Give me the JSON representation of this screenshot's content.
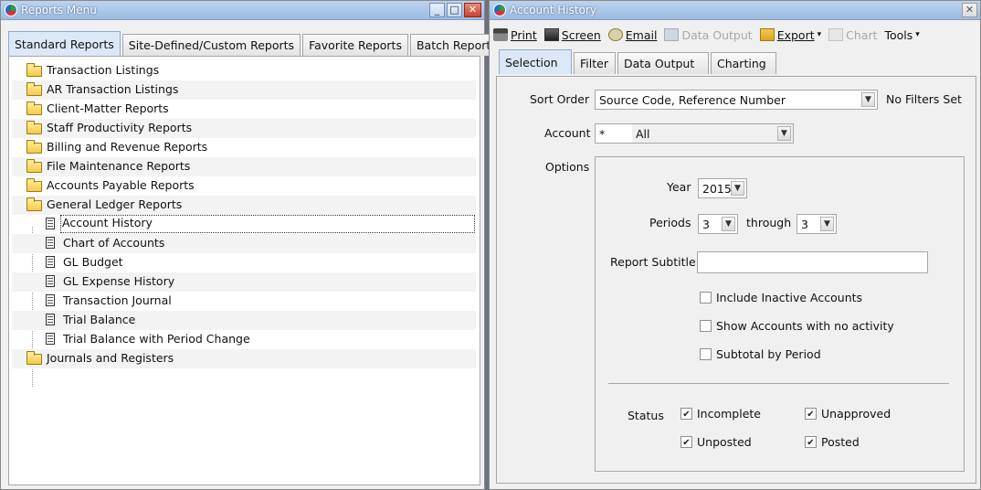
{
  "reports_window": {
    "title": "Reports Menu",
    "buttons": {
      "minimize": "_",
      "maximize": "□",
      "close": "✕"
    },
    "tabs": [
      "Standard Reports",
      "Site-Defined/Custom Reports",
      "Favorite Reports",
      "Batch Reports"
    ],
    "active_tab": "Standard Reports",
    "tree": [
      {
        "type": "folder",
        "label": "Transaction Listings"
      },
      {
        "type": "folder",
        "label": "AR Transaction Listings"
      },
      {
        "type": "folder",
        "label": "Client-Matter Reports"
      },
      {
        "type": "folder",
        "label": "Staff Productivity Reports"
      },
      {
        "type": "folder",
        "label": "Billing and Revenue Reports"
      },
      {
        "type": "folder",
        "label": "File Maintenance Reports"
      },
      {
        "type": "folder",
        "label": "Accounts Payable Reports"
      },
      {
        "type": "folder",
        "label": "General Ledger Reports"
      },
      {
        "type": "doc",
        "label": "Account History",
        "selected": true
      },
      {
        "type": "doc",
        "label": "Chart of Accounts"
      },
      {
        "type": "doc",
        "label": "GL Budget"
      },
      {
        "type": "doc",
        "label": "GL Expense History"
      },
      {
        "type": "doc",
        "label": "Transaction Journal"
      },
      {
        "type": "doc",
        "label": "Trial Balance"
      },
      {
        "type": "doc",
        "label": "Trial Balance with Period Change"
      },
      {
        "type": "folder",
        "label": "Journals and Registers"
      }
    ]
  },
  "account_window": {
    "title": "Account History",
    "close": "✕",
    "toolbar": {
      "print": "Print",
      "screen": "Screen",
      "email": "Email",
      "data_output": "Data Output",
      "export": "Export",
      "chart": "Chart",
      "tools": "Tools",
      "dropdown_caret": "▾"
    },
    "tabs": [
      "Selection",
      "Filter",
      "Data Output",
      "Charting"
    ],
    "active_tab": "Selection",
    "form": {
      "sort_order_label": "Sort Order",
      "sort_order_value": "Source Code, Reference Number",
      "filters_status": "No Filters Set",
      "account_label": "Account",
      "account_code": "*",
      "account_value": "All",
      "options_label": "Options",
      "year_label": "Year",
      "year_value": "2015",
      "periods_label": "Periods",
      "period_from": "3",
      "through_label": "through",
      "period_to": "3",
      "subtitle_label": "Report Subtitle",
      "subtitle_value": "",
      "include_inactive": {
        "label": "Include Inactive Accounts",
        "checked": false
      },
      "show_no_activity": {
        "label": "Show Accounts with no activity",
        "checked": false
      },
      "subtotal_by_period": {
        "label": "Subtotal by Period",
        "checked": false
      },
      "status_label": "Status",
      "status": [
        {
          "label": "Incomplete",
          "checked": true
        },
        {
          "label": "Unapproved",
          "checked": true
        },
        {
          "label": "Unposted",
          "checked": true
        },
        {
          "label": "Posted",
          "checked": true
        }
      ],
      "combo_arrow": "▼"
    }
  }
}
